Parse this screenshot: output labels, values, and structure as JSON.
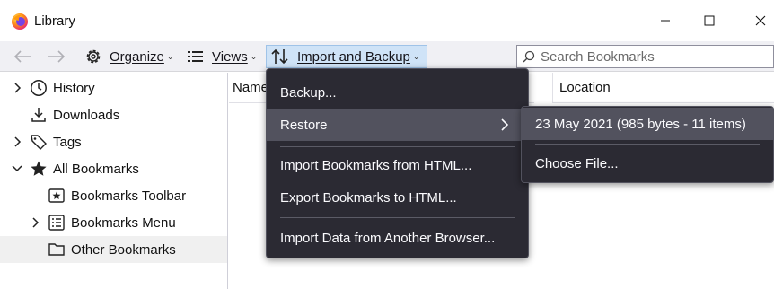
{
  "window": {
    "title": "Library",
    "controls": [
      "minimize",
      "maximize",
      "close"
    ]
  },
  "toolbar": {
    "back_icon": "arrow-left-icon",
    "forward_icon": "arrow-right-icon",
    "organize": "Organize",
    "views": "Views",
    "import_backup": "Import and Backup",
    "search_placeholder": "Search Bookmarks"
  },
  "tree": {
    "items": [
      {
        "label": "History",
        "icon": "clock-icon",
        "twisty": "collapsed"
      },
      {
        "label": "Downloads",
        "icon": "download-icon",
        "twisty": "none"
      },
      {
        "label": "Tags",
        "icon": "tag-icon",
        "twisty": "collapsed"
      },
      {
        "label": "All Bookmarks",
        "icon": "star-icon",
        "twisty": "expanded"
      },
      {
        "label": "Bookmarks Toolbar",
        "icon": "bookmark-toolbar-icon",
        "twisty": "none"
      },
      {
        "label": "Bookmarks Menu",
        "icon": "bookmark-menu-icon",
        "twisty": "collapsed"
      },
      {
        "label": "Other Bookmarks",
        "icon": "folder-icon",
        "twisty": "none",
        "selected": true
      }
    ]
  },
  "columns": {
    "name": "Name",
    "location": "Location"
  },
  "menu": {
    "backup": "Backup...",
    "restore": "Restore",
    "import_html": "Import Bookmarks from HTML...",
    "export_html": "Export Bookmarks to HTML...",
    "import_browser": "Import Data from Another Browser..."
  },
  "submenu": {
    "backup_entry": "23 May 2021 (985 bytes - 11 items)",
    "choose_file": "Choose File..."
  },
  "colors": {
    "menu_bg": "#2b2a33",
    "menu_highlight": "#52525e",
    "toolbar_bg": "#f0f0f4",
    "active_button": "#cfe3f7"
  }
}
